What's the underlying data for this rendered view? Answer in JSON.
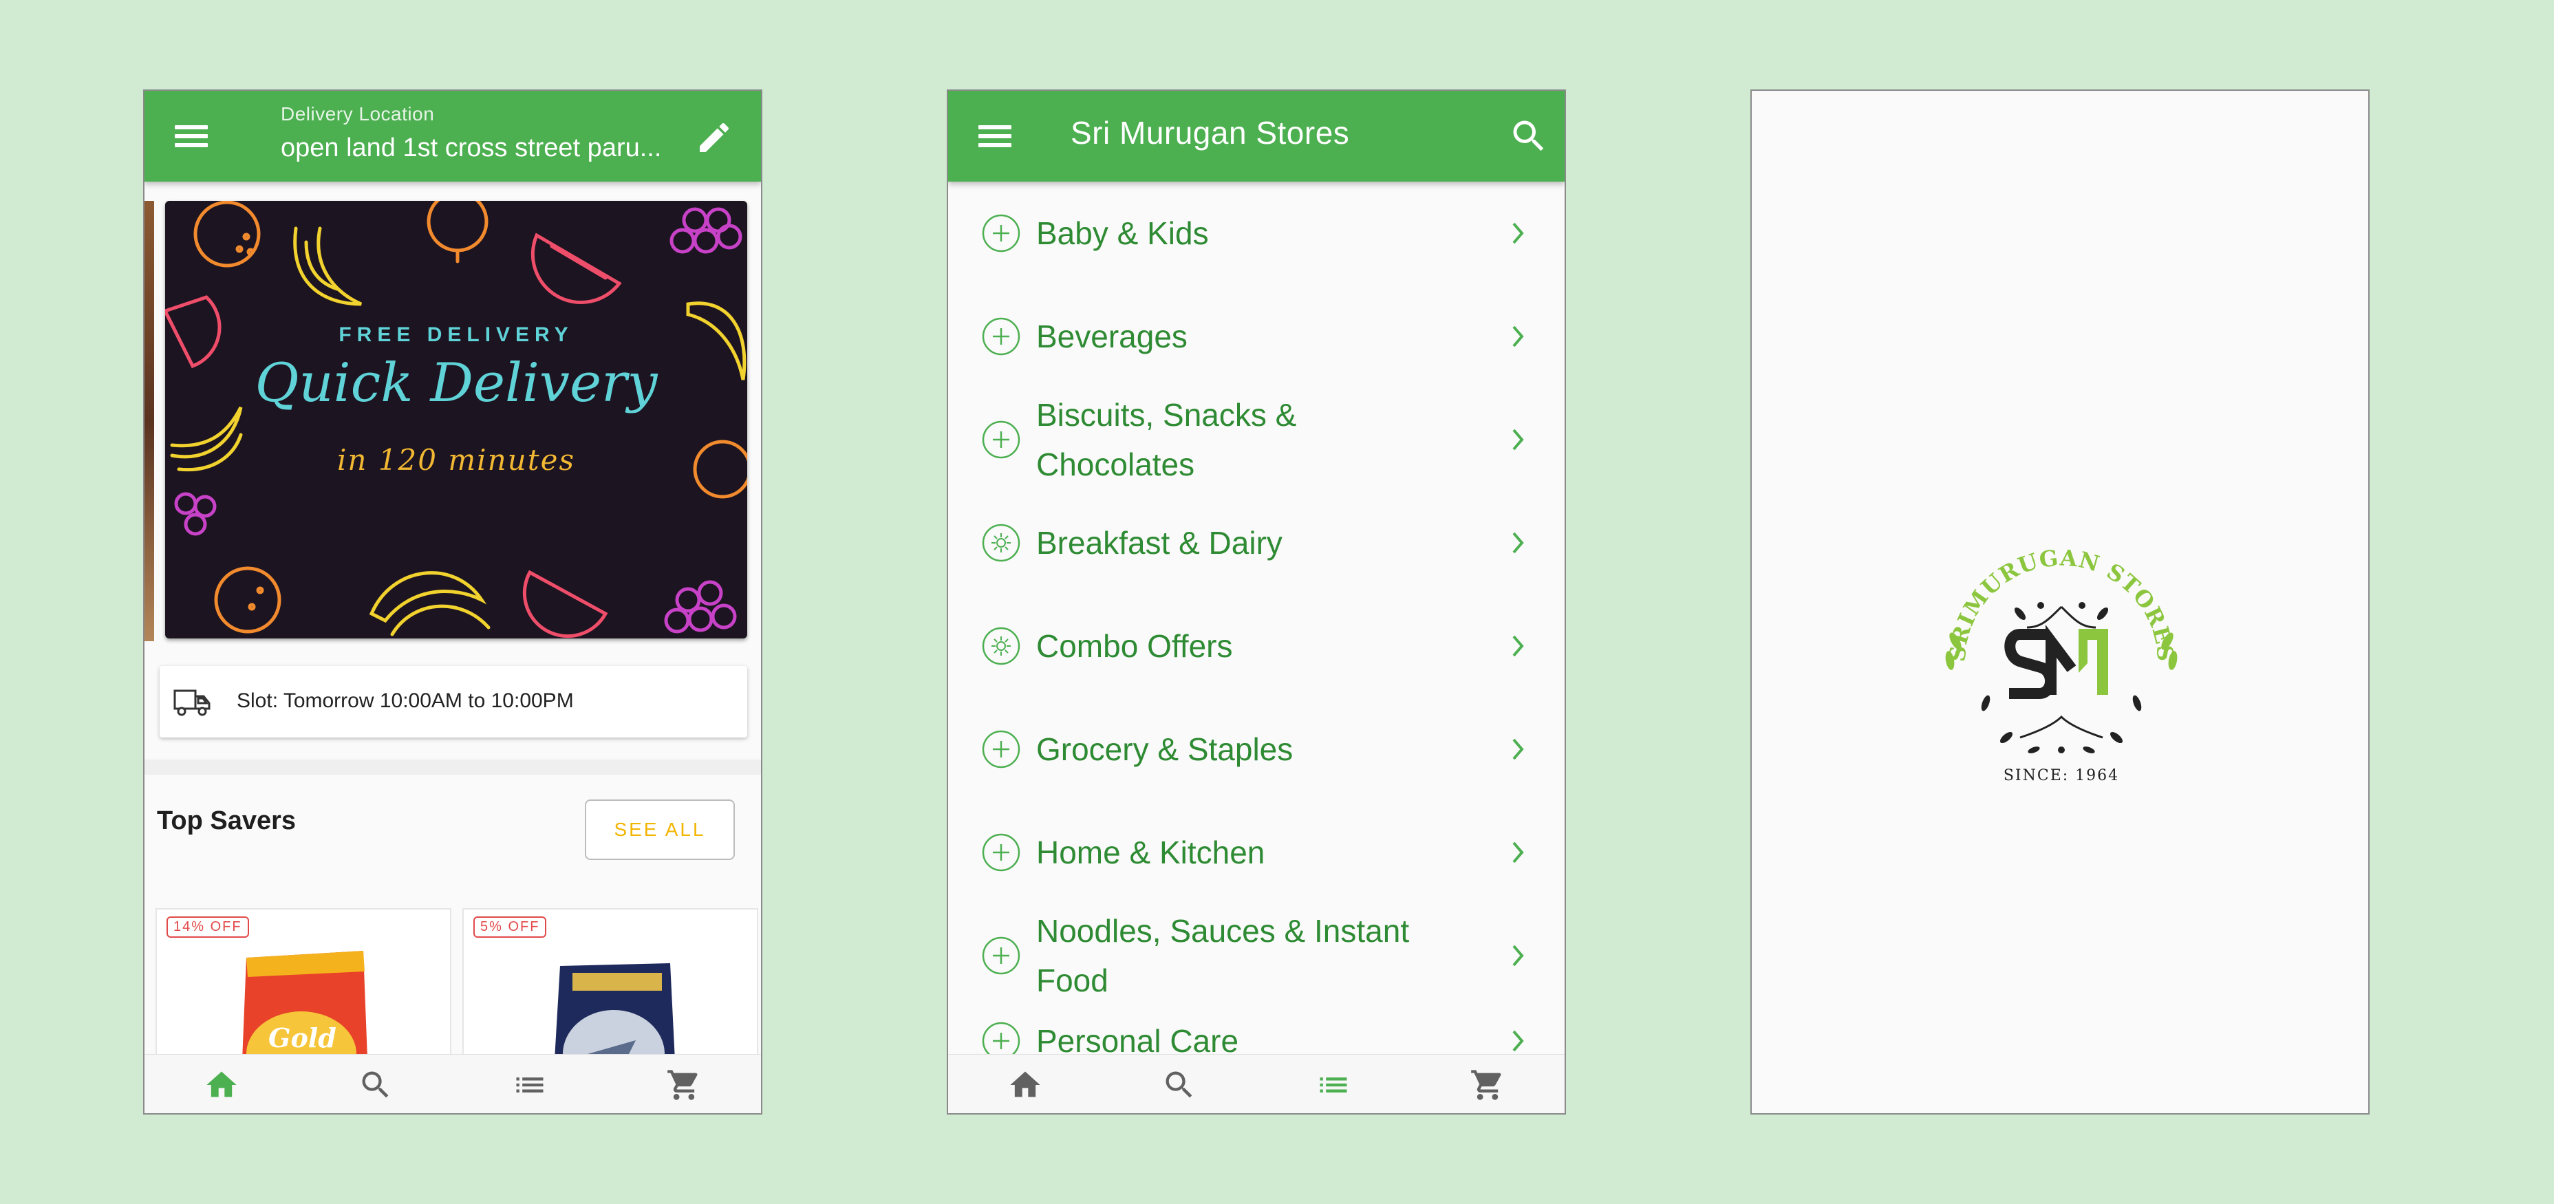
{
  "home": {
    "delivery_label": "Delivery Location",
    "delivery_address": "open land 1st cross street paru...",
    "banner": {
      "subtitle": "FREE DELIVERY",
      "title": "Quick Delivery",
      "note": "in 120 minutes"
    },
    "slot_text": "Slot: Tomorrow 10:00AM to 10:00PM",
    "section_title": "Top Savers",
    "see_all_label": "SEE ALL",
    "products": [
      {
        "badge": "14% OFF",
        "name": "Gold Winner"
      },
      {
        "badge": "5% OFF",
        "name": ""
      }
    ]
  },
  "categories": {
    "title": "Sri Murugan Stores",
    "items": [
      {
        "label": "Baby & Kids",
        "icon": "plus-circle-icon"
      },
      {
        "label": "Beverages",
        "icon": "plus-circle-icon"
      },
      {
        "label": "Biscuits, Snacks & Chocolates",
        "icon": "plus-circle-icon"
      },
      {
        "label": "Breakfast & Dairy",
        "icon": "sun-circle-icon"
      },
      {
        "label": "Combo Offers",
        "icon": "sun-circle-icon"
      },
      {
        "label": "Grocery & Staples",
        "icon": "plus-circle-icon"
      },
      {
        "label": "Home & Kitchen",
        "icon": "plus-circle-icon"
      },
      {
        "label": "Noodles, Sauces & Instant Food",
        "icon": "plus-circle-icon"
      },
      {
        "label": "Personal Care",
        "icon": "plus-circle-icon"
      }
    ]
  },
  "splash": {
    "logo_text_top": "SRIMURUGAN STORES",
    "logo_mark": "SM",
    "logo_text_bottom": "SINCE: 1964"
  },
  "nav": {
    "items": [
      "home-icon",
      "search-icon",
      "list-icon",
      "cart-icon"
    ],
    "active_color": "#4caf50",
    "inactive_color": "#616161"
  },
  "colors": {
    "primary": "#4caf50",
    "category_text": "#2e8b33",
    "background": "#d1ead2",
    "see_all": "#f2b500",
    "discount": "#e24a4a"
  }
}
